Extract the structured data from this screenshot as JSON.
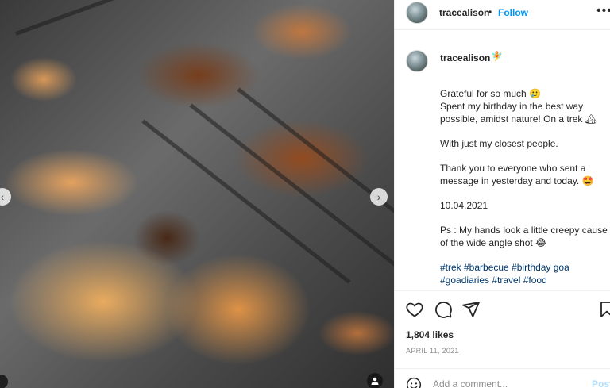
{
  "post": {
    "username": "tracealison",
    "follow_label": "Follow",
    "separator": "•",
    "more_label": "•••",
    "badge": "🧚"
  },
  "caption": {
    "line1": "Grateful for so much 🥲",
    "line2": "Spent my birthday in the best way possible, amidst nature! On a trek 🏔",
    "line3": "With just my closest people.",
    "line4": "Thank you to everyone who sent a message in yesterday and today. 🤩",
    "line5": "10.04.2021",
    "line6": "Ps : My hands look a little creepy cause of the wide angle shot 😂",
    "hashtags": "#trek #barbecue #birthday goa",
    "hashtags_more": "#goadiaries #travel #food"
  },
  "engagement": {
    "likes": "1,804 likes",
    "date": "APRIL 11, 2021"
  },
  "comment": {
    "placeholder": "Add a comment...",
    "post_label": "Post"
  },
  "icons": {
    "like": "heart-icon",
    "comment": "comment-icon",
    "share": "share-icon",
    "save": "bookmark-icon",
    "emoji": "emoji-icon",
    "prev": "chevron-left-icon",
    "next": "chevron-right-icon",
    "tag": "user-tag-icon"
  },
  "colors": {
    "accent": "#0095f6",
    "post_disabled": "#b2dffc",
    "text": "#262626",
    "muted": "#8e8e8e",
    "hashtag": "#00376b"
  }
}
